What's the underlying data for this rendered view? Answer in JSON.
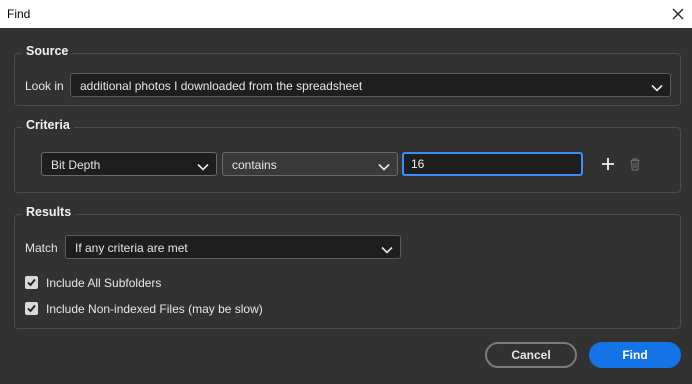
{
  "window": {
    "title": "Find"
  },
  "source": {
    "legend": "Source",
    "look_in_label": "Look in",
    "look_in_value": "additional photos I downloaded from the spreadsheet"
  },
  "criteria": {
    "legend": "Criteria",
    "field": "Bit Depth",
    "operator": "contains",
    "value": "16"
  },
  "results": {
    "legend": "Results",
    "match_label": "Match",
    "match_value": "If any criteria are met",
    "include_subfolders": {
      "label": "Include All Subfolders",
      "checked": true
    },
    "include_nonindexed": {
      "label": "Include Non-indexed Files (may be slow)",
      "checked": true
    }
  },
  "buttons": {
    "cancel": "Cancel",
    "find": "Find"
  },
  "colors": {
    "accent": "#1473e6",
    "focus": "#3b8ef7",
    "background": "#323232",
    "field": "#1e1e1e"
  }
}
